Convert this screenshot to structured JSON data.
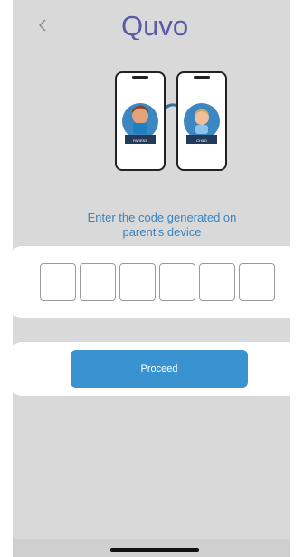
{
  "app": {
    "logo_text": "Quvo"
  },
  "illustration": {
    "parent_label": "PARENT",
    "child_label": "CHILD"
  },
  "prompt": {
    "line1": "Enter the code generated on",
    "line2": "parent's device"
  },
  "code_input": {
    "digits": [
      "",
      "",
      "",
      "",
      "",
      ""
    ]
  },
  "actions": {
    "proceed_label": "Proceed"
  },
  "colors": {
    "brand": "#5b5aa8",
    "accent": "#3893d0",
    "prompt_text": "#3b83bd",
    "screen_background": "#d9d9d9"
  },
  "icons": {
    "back": "chevron-left-icon"
  }
}
